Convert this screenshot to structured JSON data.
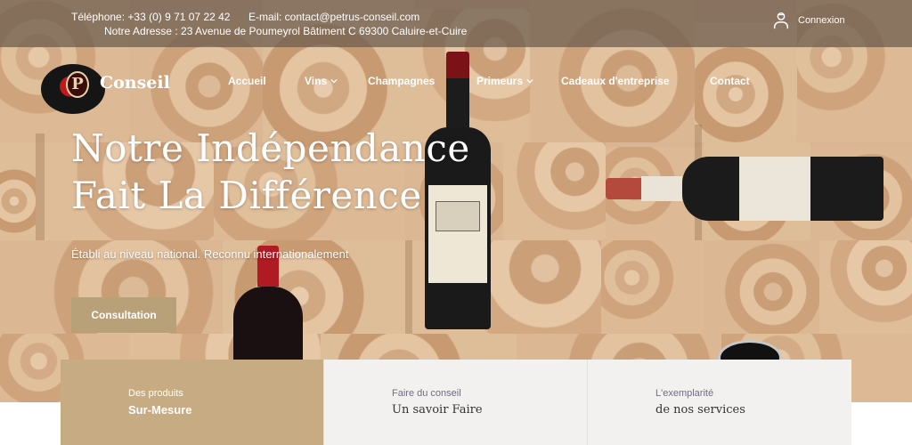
{
  "topbar": {
    "phone": "Téléphone: +33 (0) 9 71 07 22 42",
    "email": "E-mail: contact@petrus-conseil.com",
    "address": "Notre Adresse : 23 Avenue de Poumeyrol Bâtiment C 69300 Caluire-et-Cuire",
    "login_label": "Connexion",
    "login_icon": "user-icon"
  },
  "logo": {
    "initial": "P",
    "name": "Conseil"
  },
  "nav": {
    "items": [
      {
        "label": "Accueil",
        "dropdown": false
      },
      {
        "label": "Vins",
        "dropdown": true
      },
      {
        "label": "Champagnes",
        "dropdown": false
      },
      {
        "label": "Primeurs",
        "dropdown": true
      },
      {
        "label": "Cadeaux d'entreprise",
        "dropdown": false
      },
      {
        "label": "Contact",
        "dropdown": false
      }
    ]
  },
  "hero": {
    "headline_line1": "Notre Indépendance",
    "headline_line2": "Fait La Différence",
    "subtitle": "Établi au niveau national. Reconnu internationalement",
    "cta_label": "Consultation"
  },
  "cards": [
    {
      "small": "Des produits",
      "big": "Sur-Mesure"
    },
    {
      "small": "Faire du conseil",
      "big": "Un savoir Faire"
    },
    {
      "small": "L'exemplarité",
      "big": "de nos services"
    }
  ],
  "colors": {
    "accent": "#c7ab82",
    "button": "#b8a079",
    "topbar": "#695a4c",
    "card_bg": "#f3f1ef"
  }
}
